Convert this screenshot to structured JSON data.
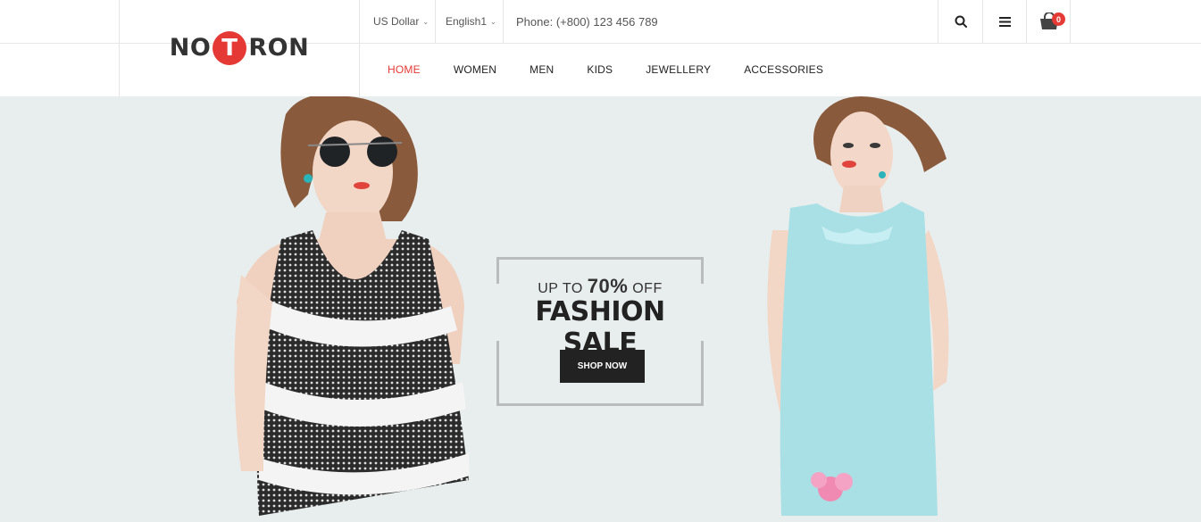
{
  "brand": {
    "logo_left": "NO",
    "logo_mid": "T",
    "logo_right": "RON"
  },
  "topbar": {
    "currency": "US Dollar",
    "language": "English1",
    "phone": "Phone: (+800) 123 456 789",
    "cart_count": "0"
  },
  "nav": {
    "items": [
      {
        "label": "HOME"
      },
      {
        "label": "WOMEN"
      },
      {
        "label": "MEN"
      },
      {
        "label": "KIDS"
      },
      {
        "label": "JEWELLERY"
      },
      {
        "label": "ACCESSORIES"
      }
    ],
    "active_index": 0
  },
  "hero": {
    "line1_prefix": "UP TO",
    "line1_percent": "70%",
    "line1_suffix": "OFF",
    "title": "FASHION SALE",
    "button_label": "SHOP NOW"
  },
  "colors": {
    "accent": "#e53935",
    "hero_bg": "#e8eded",
    "button_bg": "#222222"
  },
  "icons": {
    "search": "search-icon",
    "menu": "menu-icon",
    "cart": "cart-icon"
  }
}
